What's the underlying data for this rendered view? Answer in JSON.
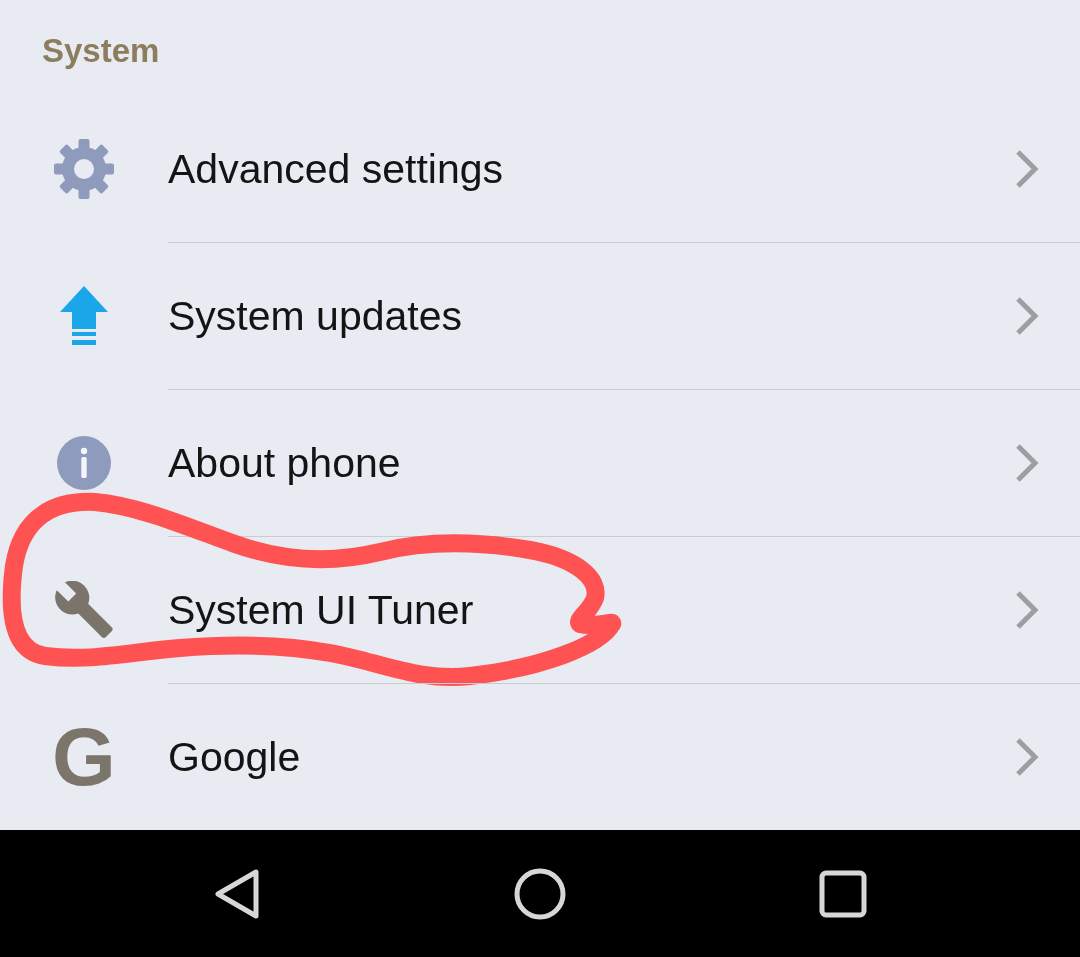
{
  "header": {
    "title": "System"
  },
  "items": [
    {
      "label": "Advanced settings",
      "circled": false
    },
    {
      "label": "System updates",
      "circled": false
    },
    {
      "label": "About phone",
      "circled": false
    },
    {
      "label": "System UI Tuner",
      "circled": true
    },
    {
      "label": "Google",
      "circled": false,
      "logo_letter": "G"
    }
  ]
}
